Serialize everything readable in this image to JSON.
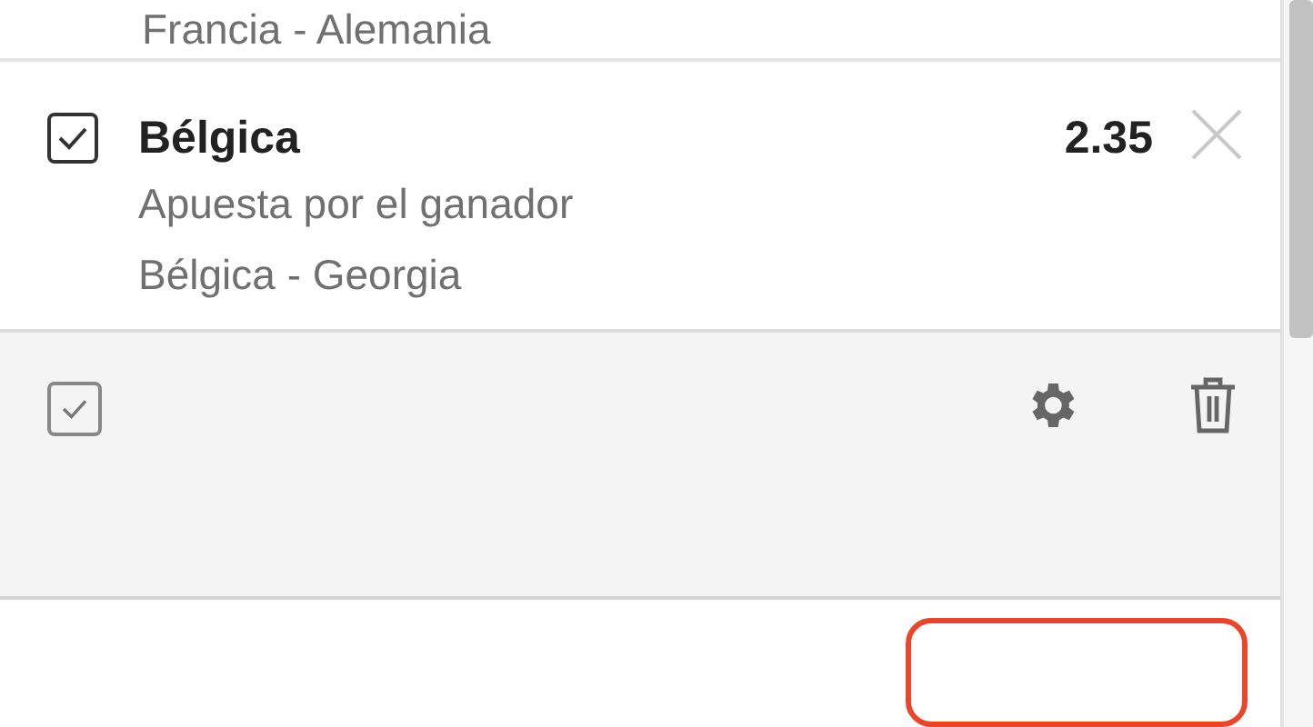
{
  "previous_selection": {
    "match": "Francia - Alemania"
  },
  "selections": [
    {
      "checked": true,
      "title": "Bélgica",
      "odds": "2.35",
      "market": "Apuesta por el ganador",
      "match": "Bélgica - Georgia"
    }
  ],
  "toolbar": {
    "select_all_checked": true
  }
}
